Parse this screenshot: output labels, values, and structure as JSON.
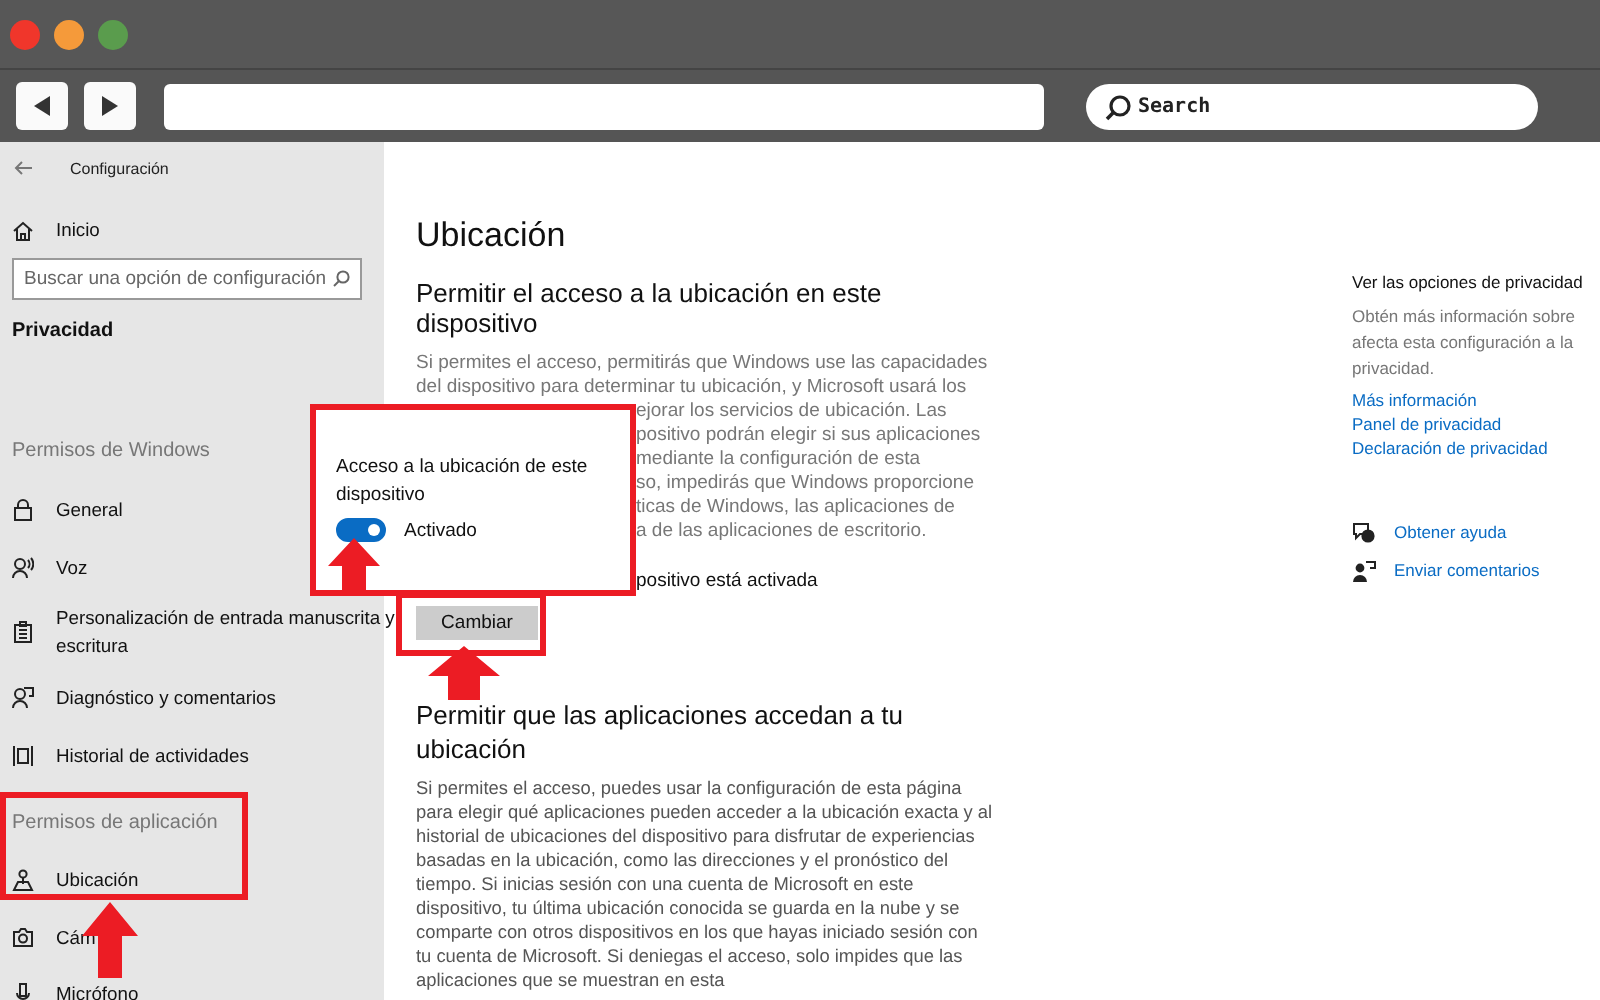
{
  "browser": {
    "search_placeholder": "Search"
  },
  "window": {
    "title": "Configuración"
  },
  "sidebar": {
    "home": "Inicio",
    "search_placeholder": "Buscar una opción de configuración",
    "category": "Privacidad",
    "sections": [
      {
        "title": "Permisos de Windows",
        "highlighted": false,
        "items": [
          "General",
          "Voz",
          "Personalización de entrada manuscrita y escritura",
          "Diagnóstico y comentarios",
          "Historial de actividades"
        ]
      },
      {
        "title": "Permisos de aplicación",
        "highlighted": true,
        "items": [
          "Ubicación",
          "Cám",
          "Micrófono"
        ]
      }
    ]
  },
  "main": {
    "title": "Ubicación",
    "section1": {
      "heading": "Permitir el acceso a la ubicación en este dispositivo",
      "lines": [
        "Si permites el acceso, permitirás que Windows use las capacidades",
        "del dispositivo para determinar tu ubicación, y Microsoft usará los"
      ],
      "covered_lines": [
        "ejorar los servicios de ubicación. Las",
        "positivo podrán elegir si sus aplicaciones",
        "mediante la configuración de esta",
        "so, impedirás que Windows proporcione",
        "ticas de Windows, las aplicaciones de",
        "a de las aplicaciones de escritorio."
      ],
      "status": "positivo está activada",
      "button": "Cambiar",
      "button_highlighted": true
    },
    "section2": {
      "heading": "Permitir que las aplicaciones accedan a tu ubicación",
      "body": "Si permites el acceso, puedes usar la configuración de esta página para elegir qué aplicaciones pueden acceder a la ubicación exacta y al historial de ubicaciones del dispositivo para disfrutar de experiencias basadas en la ubicación, como las direcciones y el pronóstico del tiempo. Si inicias sesión con una cuenta de Microsoft en este dispositivo, tu última ubicación conocida se guarda en la nube y se comparte con otros dispositivos en los que hayas iniciado sesión con tu cuenta de Microsoft. Si deniegas el acceso, solo impides que las aplicaciones que se muestran en esta"
    }
  },
  "aside": {
    "heading": "Ver las opciones de privacidad",
    "text": "Obtén más información sobre afecta esta configuración a la privacidad.",
    "links": [
      "Más información",
      "Panel de privacidad",
      "Declaración de privacidad"
    ],
    "actions": [
      "Obtener ayuda",
      "Enviar comentarios"
    ]
  },
  "popup": {
    "label": "Acceso a la ubicación de este dispositivo",
    "toggle": {
      "on": true,
      "label": "Activado"
    }
  }
}
